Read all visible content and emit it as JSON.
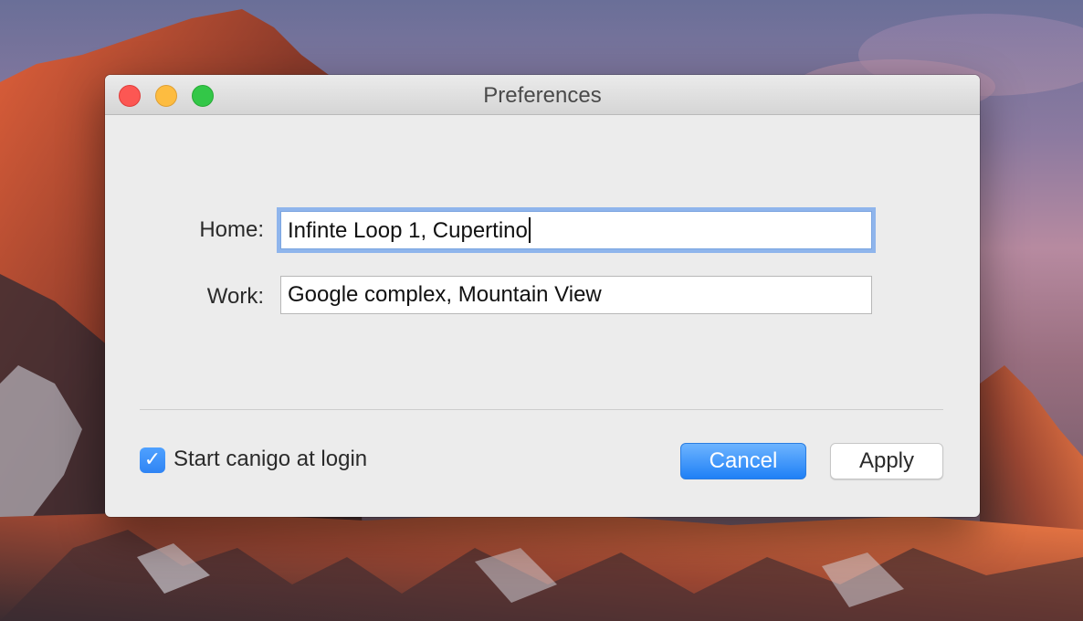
{
  "window": {
    "title": "Preferences"
  },
  "form": {
    "home_label": "Home:",
    "home_value": "Infinte Loop 1, Cupertino",
    "work_label": "Work:",
    "work_value": "Google complex, Mountain View"
  },
  "login_option": {
    "label": "Start canigo at login",
    "checked": true,
    "check_glyph": "✓"
  },
  "buttons": {
    "cancel_label": "Cancel",
    "apply_label": "Apply"
  },
  "colors": {
    "accent": "#2f84f4",
    "close": "#fc5753",
    "minimize": "#fdbc40",
    "zoom": "#33c748"
  }
}
